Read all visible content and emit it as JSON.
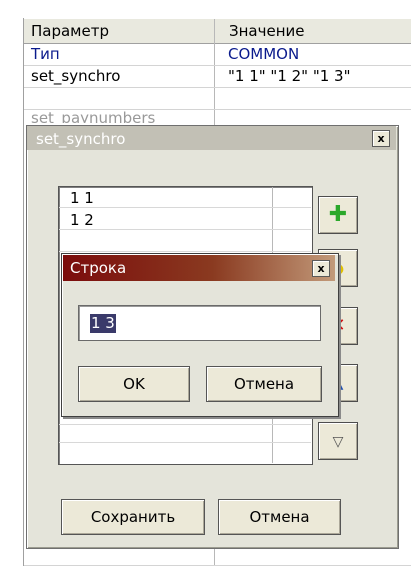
{
  "grid": {
    "headers": [
      "Параметр",
      "Значение"
    ],
    "rows": [
      {
        "param": "Тип",
        "value": "COMMON"
      },
      {
        "param": "set_synchro",
        "value": "\"1 1\" \"1 2\" \"1 3\""
      },
      {
        "param": "set_paynumbers",
        "value": ""
      }
    ]
  },
  "dialog_main": {
    "title": "set_synchro",
    "close_glyph": "x",
    "items": [
      "1 1",
      "1 2"
    ],
    "side_buttons": [
      {
        "icon": "plus-icon",
        "glyph": "✚",
        "color": "#2aa82a"
      },
      {
        "icon": "yellow-icon",
        "glyph": "●",
        "color": "#e0c000"
      },
      {
        "icon": "delete-icon",
        "glyph": "✕",
        "color": "#d01010"
      },
      {
        "icon": "arrow-up-icon",
        "glyph": "▲",
        "color": "#1f4fb0"
      },
      {
        "icon": "arrow-down-icon",
        "glyph": "▽",
        "color": "#555555"
      }
    ],
    "save_label": "Сохранить",
    "cancel_label": "Отмена"
  },
  "dialog_string": {
    "title": "Строка",
    "close_glyph": "x",
    "input_value": "1 3",
    "ok_label": "OK",
    "cancel_label": "Отмена"
  }
}
